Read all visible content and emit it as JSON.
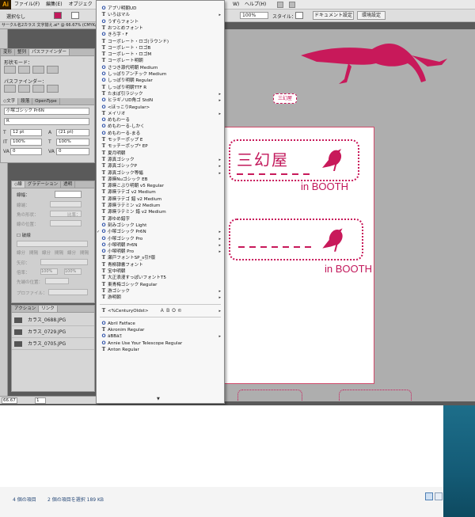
{
  "menubar": {
    "logo": "Ai",
    "items": [
      "ファイル(F)",
      "編集(E)",
      "オブジェク"
    ],
    "right_item": "W)",
    "right_item2": "ヘルプ(H)"
  },
  "controlbar": {
    "selection": "選択なし",
    "zoom": "100%",
    "style_label": "スタイル：",
    "doc_settings_button": "ドキュメント設定",
    "prefs_button": "環境設定"
  },
  "document_tab": "サークル名2カラス 文字揃え.ai* @ 66.67% (CMYK/",
  "panels": {
    "upper_tabs": [
      "変形",
      "整列",
      "パスファインダー"
    ],
    "shape_mode_label": "形状モード：",
    "pathfinder_label": "パスファインダー：",
    "char_tabs": [
      "◇文字",
      "段落",
      "OpenType"
    ],
    "font_family": "小塚ゴシック Pr6N",
    "font_style": "R",
    "font_size": "12 pt",
    "leading": "(21 pt)",
    "vertical_scale": "100%",
    "horizontal_scale": "100%",
    "kerning": "0",
    "tracking": "0",
    "stroke_tabs": [
      "◇線",
      "グラデーション",
      "透明"
    ],
    "stroke_weight_label": "線幅：",
    "stroke_rows": [
      "線端：",
      "角の形状：",
      "線の位置："
    ],
    "limit_label": "比率：",
    "dashed_label": "破線",
    "dash_fields": [
      "線分",
      "間隔",
      "線分",
      "間隔",
      "線分",
      "間隔"
    ],
    "arrow_label": "矢印：",
    "scale_label": "倍率：",
    "scale_values": [
      "100%",
      "100%"
    ],
    "position_label": "先端の位置：",
    "profile_label": "プロファイル：",
    "links_tabs": [
      "アクション",
      "リンク"
    ],
    "links": [
      "カラス_0688.JPG",
      "カラス_0729.JPG",
      "カラス_0705.JPG"
    ]
  },
  "status_zoom": "66.67",
  "status_page": "1",
  "font_menu": {
    "items": [
      {
        "icon": "O",
        "name": "アプリ明朝UD",
        "arrow": false
      },
      {
        "icon": "T",
        "name": "いろはマル",
        "arrow": true
      },
      {
        "icon": "O",
        "name": "うずらフォント",
        "arrow": false
      },
      {
        "icon": "T",
        "name": "おつとめフォント",
        "arrow": false
      },
      {
        "icon": "O",
        "name": "きろ字・F",
        "arrow": false
      },
      {
        "icon": "T",
        "name": "コーポレート・ロゴ(ラウンド)",
        "arrow": false
      },
      {
        "icon": "T",
        "name": "コーポレート・ロゴB",
        "arrow": false
      },
      {
        "icon": "T",
        "name": "コーポレート・ロゴM",
        "arrow": false
      },
      {
        "icon": "T",
        "name": "コーポレート明朝",
        "arrow": false
      },
      {
        "icon": "O",
        "name": "さつき源代明朝 Medium",
        "arrow": false
      },
      {
        "icon": "O",
        "name": "しっぽりアンチック Medium",
        "arrow": false
      },
      {
        "icon": "O",
        "name": "しっぽり明朝 Regular",
        "arrow": false
      },
      {
        "icon": "T",
        "name": "しっぽり明朝TTF R",
        "arrow": false
      },
      {
        "icon": "T",
        "name": "たまぽ引ラジック",
        "arrow": true
      },
      {
        "icon": "O",
        "name": "ヒラギノUD角ゴ StdN",
        "arrow": true
      },
      {
        "icon": "O",
        "name": "<ほっこりRegular>",
        "arrow": false
      },
      {
        "icon": "T",
        "name": "メイリオ",
        "arrow": true
      },
      {
        "icon": "O",
        "name": "めもわーる",
        "arrow": false
      },
      {
        "icon": "O",
        "name": "めもわーる-しかく",
        "arrow": false
      },
      {
        "icon": "O",
        "name": "めもわーる-まる",
        "arrow": false
      },
      {
        "icon": "T",
        "name": "モッチーポップ E",
        "arrow": false
      },
      {
        "icon": "T",
        "name": "モッチーポップ* EP",
        "arrow": false
      },
      {
        "icon": "T",
        "name": "夏月明朝",
        "arrow": false
      },
      {
        "icon": "T",
        "name": "源真ゴシック",
        "arrow": true
      },
      {
        "icon": "T",
        "name": "源真ゴシックP",
        "arrow": true
      },
      {
        "icon": "T",
        "name": "源真ゴシック等幅",
        "arrow": true
      },
      {
        "icon": "T",
        "name": "源暎Nuゴシック EB",
        "arrow": false
      },
      {
        "icon": "T",
        "name": "源暎こぶり明朝 v5 Regular",
        "arrow": false
      },
      {
        "icon": "T",
        "name": "源暎ラテゴ v2 Medium",
        "arrow": false
      },
      {
        "icon": "T",
        "name": "源暎ラテゴ 錯 v2 Medium",
        "arrow": false
      },
      {
        "icon": "T",
        "name": "源暎ラテミン v2 Medium",
        "arrow": false
      },
      {
        "icon": "T",
        "name": "源暎ラテミン 錯 v2 Medium",
        "arrow": false
      },
      {
        "icon": "T",
        "name": "源ゆめ錯字",
        "arrow": false
      },
      {
        "icon": "O",
        "name": "刻みゴシック Light",
        "arrow": false
      },
      {
        "icon": "O",
        "name": "小塚ゴシック Pr6N",
        "arrow": true,
        "checked": true
      },
      {
        "icon": "O",
        "name": "小塚ゴシック Pro",
        "arrow": true
      },
      {
        "icon": "O",
        "name": "小塚明朝 Pr6N",
        "arrow": true
      },
      {
        "icon": "O",
        "name": "小塚明朝 Pro",
        "arrow": true
      },
      {
        "icon": "T",
        "name": "瀬戸フォントSP_s引ﾁ版",
        "arrow": false
      },
      {
        "icon": "T",
        "name": "青柳隷書フォント",
        "arrow": false
      },
      {
        "icon": "T",
        "name": "宝中明朝",
        "arrow": false
      },
      {
        "icon": "T",
        "name": "大正浪漫すっぽいフォントT5",
        "arrow": false
      },
      {
        "icon": "T",
        "name": "東青梅ゴシック Regular",
        "arrow": false
      },
      {
        "icon": "T",
        "name": "游ゴシック",
        "arrow": true
      },
      {
        "icon": "T",
        "name": "游明朝",
        "arrow": true
      },
      {
        "separator": true
      },
      {
        "icon": "T",
        "name": "<%CenturyOldst>",
        "name2": "Ａ Ｂ Ｏ ©",
        "arrow": true
      },
      {
        "separator": true
      },
      {
        "icon": "O",
        "name": "Abril Fatface",
        "arrow": false
      },
      {
        "icon": "T",
        "name": "Akronim Regular",
        "arrow": false
      },
      {
        "icon": "O",
        "name": "āBBāΞ",
        "arrow": true
      },
      {
        "icon": "O",
        "name": "Annie Use Your Telescope Regular",
        "arrow": false
      },
      {
        "icon": "T",
        "name": "Anton Regular",
        "arrow": false
      }
    ]
  },
  "artboard": {
    "badge1_text": "三幻屋",
    "badge1_sub": "in BOOTH",
    "badge2_sub": "in BOOTH",
    "small_tag": "三幻屋"
  },
  "explorer": {
    "item_count": "4 個の項目",
    "selected": "2 個の項目を選択  189 KB"
  },
  "colors": {
    "accent": "#c2185b",
    "crow": "#c8195a"
  }
}
